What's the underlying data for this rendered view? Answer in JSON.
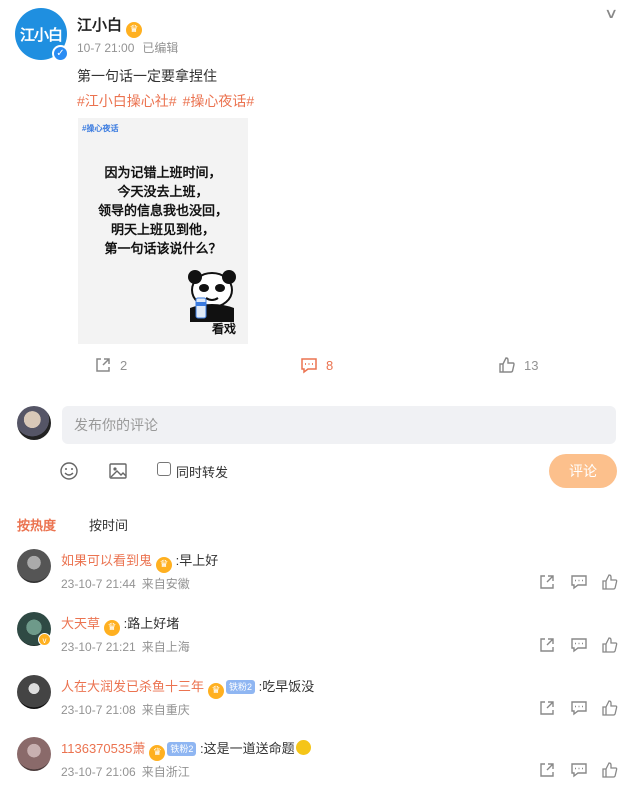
{
  "post": {
    "logo_text": "江小白",
    "author": "江小白",
    "time": "10-7 21:00",
    "edited": "已编辑",
    "text": "第一句话一定要拿捏住",
    "tags": [
      "#江小白操心社#",
      "#操心夜话#"
    ],
    "image": {
      "tag": "#操心夜话",
      "lines": [
        "因为记错上班时间，",
        "今天没去上班，",
        "领导的信息我也没回，",
        "明天上班见到他，",
        "第一句话该说什么？"
      ],
      "caption": "看戏"
    },
    "actions": {
      "share_count": "2",
      "comment_count": "8",
      "like_count": "13"
    }
  },
  "compose": {
    "placeholder": "发布你的评论",
    "repost_label": "同时转发",
    "submit_label": "评论"
  },
  "sort": {
    "hot": "按热度",
    "time": "按时间"
  },
  "comments": [
    {
      "user": "如果可以看到鬼",
      "badge": "",
      "text": ":早上好",
      "time": "23-10-7 21:44",
      "location": "来自安徽",
      "emoji": false
    },
    {
      "user": "大天草",
      "badge": "",
      "text": ":路上好堵",
      "time": "23-10-7 21:21",
      "location": "来自上海",
      "emoji": false
    },
    {
      "user": "人在大润发已杀鱼十三年",
      "badge": "铁粉2",
      "text": ":吃早饭没",
      "time": "23-10-7 21:08",
      "location": "来自重庆",
      "emoji": false
    },
    {
      "user": "1136370535萧",
      "badge": "铁粉2",
      "text": ":这是一道送命题",
      "time": "23-10-7 21:06",
      "location": "来自浙江",
      "emoji": true
    }
  ],
  "colors": {
    "accent": "#eb7350",
    "meta": "#939393",
    "input_bg": "#f0f1f4",
    "submit_bg": "#fcc08c",
    "brand_blue": "#1f8fe0"
  }
}
